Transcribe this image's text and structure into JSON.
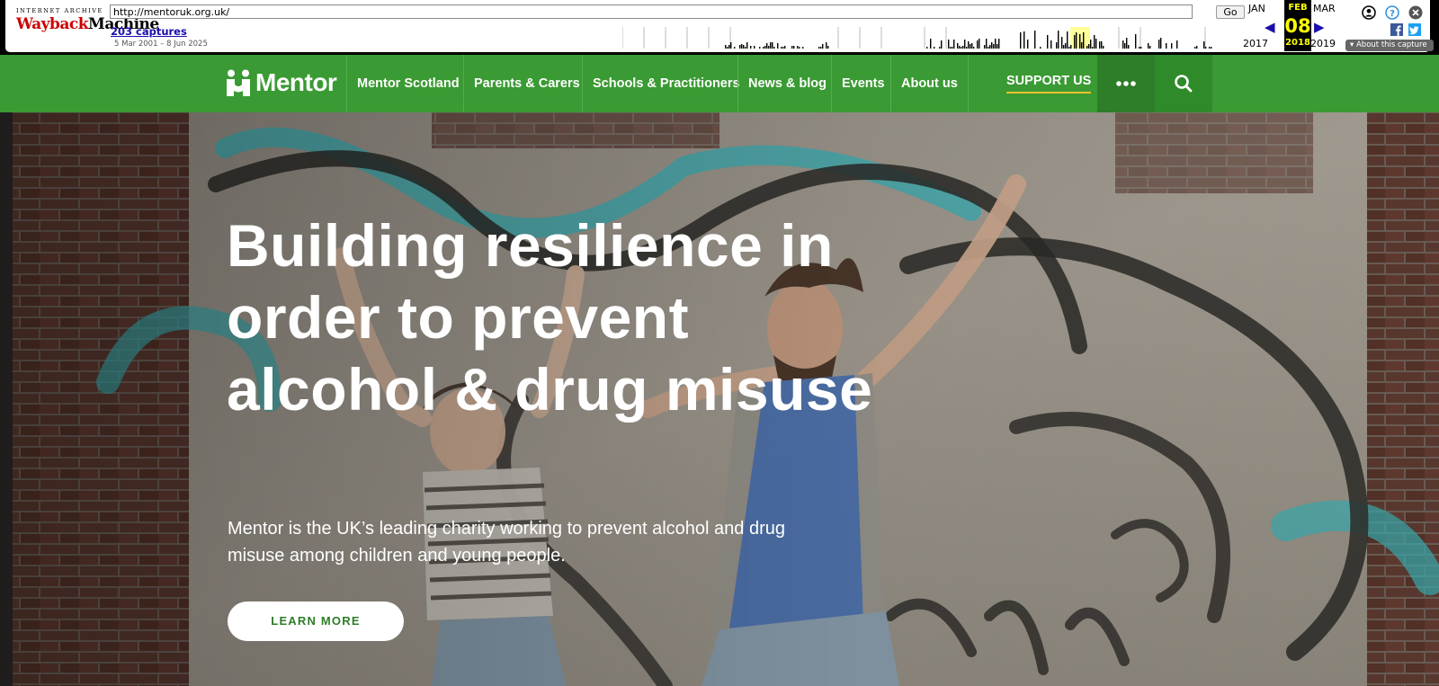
{
  "wayback": {
    "logo_top": "INTERNET ARCHIVE",
    "logo_main_1": "Wayback",
    "logo_main_2": "Machine",
    "url": "http://mentoruk.org.uk/",
    "go_label": "Go",
    "captures": "203 captures",
    "range": "5 Mar 2001 – 8 Jun 2025",
    "prev_month": "JAN",
    "cur_month": "FEB",
    "next_month": "MAR",
    "cur_day": "08",
    "prev_year": "2017",
    "cur_year": "2018",
    "next_year": "2019",
    "about": "About this capture",
    "icons": [
      "user-icon",
      "help-icon",
      "close-icon",
      "facebook-icon",
      "twitter-icon"
    ]
  },
  "nav": {
    "logo_text": "Mentor",
    "items": [
      "Mentor Scotland",
      "Parents & Carers",
      "Schools & Practitioners",
      "News & blog",
      "Events",
      "About us"
    ],
    "support": "SUPPORT US",
    "icons": [
      "more-dots-icon",
      "search-icon"
    ]
  },
  "hero": {
    "title": "Building resilience in order to prevent alcohol & drug misuse",
    "subtitle": "Mentor is the UK’s leading charity working to prevent alcohol and drug misuse among children and young people.",
    "cta": "LEARN MORE"
  },
  "colors": {
    "brand_green": "#3a9a33",
    "dark_green": "#2e7d29",
    "support_underline": "#f2c12e"
  }
}
